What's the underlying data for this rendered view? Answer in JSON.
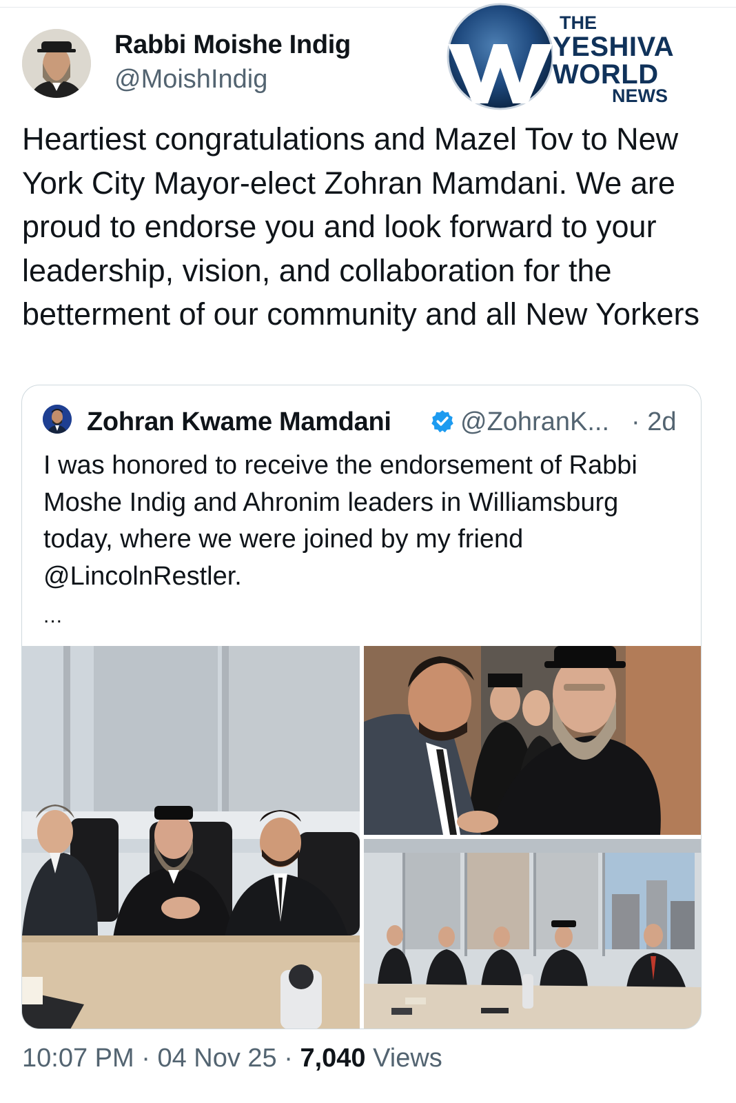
{
  "tweet": {
    "author": {
      "name": "Rabbi Moishe Indig",
      "handle": "@MoishIndig"
    },
    "text": "Heartiest congratulations and Mazel Tov to New York City Mayor-elect Zohran Mamdani. We are proud to endorse you and look forward to your leadership, vision, and collaboration for the betterment of our community and all New Yorkers",
    "meta": {
      "time": "10:07 PM",
      "date": "04 Nov 25",
      "views_count": "7,040",
      "views_label": "Views",
      "separator": "·"
    }
  },
  "quoted_tweet": {
    "author": {
      "name": "Zohran Kwame Mamdani",
      "handle": "@ZohranK...",
      "verified": true
    },
    "time": "· 2d",
    "text": "I was honored to receive the endorsement of Rabbi Moshe Indig and Ahronim leaders in Williamsburg today, where we were joined by my friend @LincolnRestler.",
    "more": "...",
    "media_count": 3
  },
  "watermark": {
    "line1": "THE",
    "line2": "YESHIVA",
    "line3": "WORLD",
    "line4": "NEWS"
  },
  "colors": {
    "text_primary": "#0f1419",
    "text_secondary": "#536471",
    "border": "#cfd9de",
    "verified": "#1d9bf0",
    "logo_navy": "#10325a"
  },
  "icons": {
    "verified": "verified-badge-icon"
  }
}
